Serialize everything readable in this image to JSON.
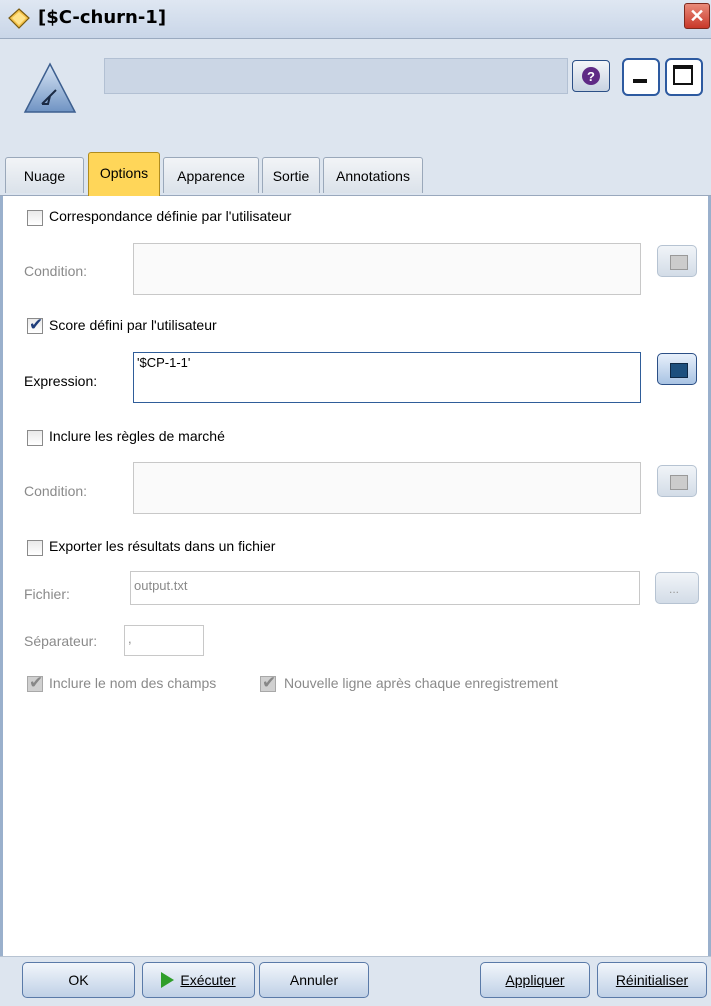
{
  "window": {
    "title": "[$C-churn-1]",
    "close_glyph": "✕",
    "help_glyph": "?",
    "accent": "#ffd659"
  },
  "tabs": [
    {
      "label": "Nuage",
      "active": false
    },
    {
      "label": "Options",
      "active": true
    },
    {
      "label": "Apparence",
      "active": false
    },
    {
      "label": "Sortie",
      "active": false
    },
    {
      "label": "Annotations",
      "active": false
    }
  ],
  "options": {
    "user_match": {
      "label": "Correspondance définie par l'utilisateur",
      "checked": false
    },
    "match_condition": {
      "label": "Condition:",
      "value": ""
    },
    "user_score": {
      "label": "Score défini par l'utilisateur",
      "checked": true
    },
    "expression": {
      "label": "Expression:",
      "value": "'$CP-1-1'"
    },
    "market_rules": {
      "label": "Inclure les règles de marché",
      "checked": false
    },
    "market_condition": {
      "label": "Condition:",
      "value": ""
    },
    "export": {
      "label": "Exporter les résultats dans un fichier",
      "checked": false
    },
    "file": {
      "label": "Fichier:",
      "value": "output.txt",
      "browse_label": "..."
    },
    "separator": {
      "label": "Séparateur:",
      "value": ","
    },
    "include_field_names": {
      "label": "Inclure le nom des champs",
      "checked": true
    },
    "newline_after_record": {
      "label": "Nouvelle ligne après chaque enregistrement",
      "checked": true
    }
  },
  "buttons": {
    "ok": "OK",
    "execute": "Exécuter",
    "cancel": "Annuler",
    "apply": "Appliquer",
    "reset": "Réinitialiser"
  }
}
